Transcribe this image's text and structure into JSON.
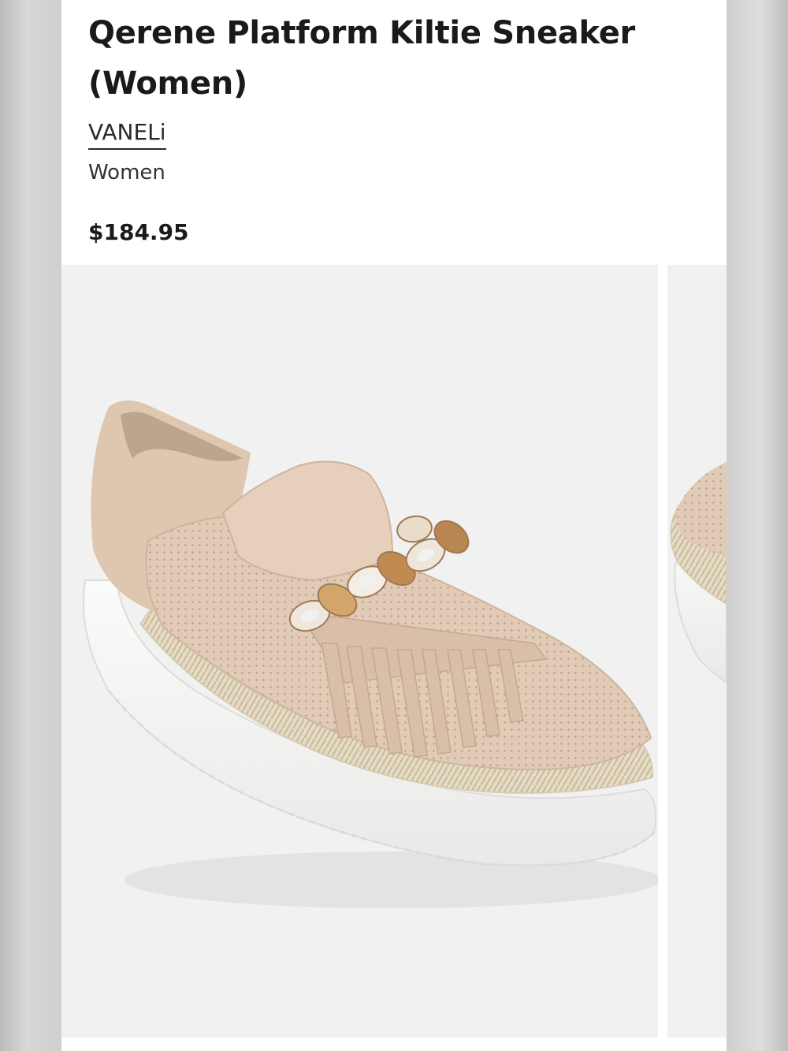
{
  "product": {
    "title": "Qerene Platform Kiltie Sneaker (Women)",
    "brand": "VANELi",
    "category": "Women",
    "price": "$184.95"
  },
  "gallery": {
    "main_image": "product-photo-beige-platform-kiltie-sneaker",
    "next_image": "product-photo-partial-next"
  },
  "colors": {
    "upper": "#e2cbb6",
    "sole": "#f7f7f5",
    "rope": "#e4dac3",
    "background": "#f1f1f1"
  }
}
